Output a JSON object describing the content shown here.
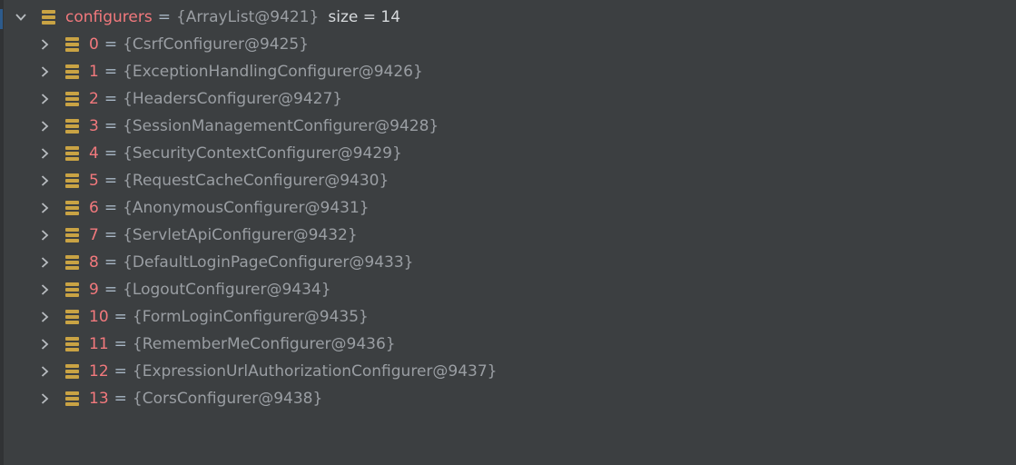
{
  "root": {
    "name": "configurers",
    "eq": "=",
    "ref": "{ArrayList@9421}",
    "size_label": "size = ",
    "size_value": "14"
  },
  "items": [
    {
      "index": "0",
      "eq": "=",
      "ref": "{CsrfConfigurer@9425}"
    },
    {
      "index": "1",
      "eq": "=",
      "ref": "{ExceptionHandlingConfigurer@9426}"
    },
    {
      "index": "2",
      "eq": "=",
      "ref": "{HeadersConfigurer@9427}"
    },
    {
      "index": "3",
      "eq": "=",
      "ref": "{SessionManagementConfigurer@9428}"
    },
    {
      "index": "4",
      "eq": "=",
      "ref": "{SecurityContextConfigurer@9429}"
    },
    {
      "index": "5",
      "eq": "=",
      "ref": "{RequestCacheConfigurer@9430}"
    },
    {
      "index": "6",
      "eq": "=",
      "ref": "{AnonymousConfigurer@9431}"
    },
    {
      "index": "7",
      "eq": "=",
      "ref": "{ServletApiConfigurer@9432}"
    },
    {
      "index": "8",
      "eq": "=",
      "ref": "{DefaultLoginPageConfigurer@9433}"
    },
    {
      "index": "9",
      "eq": "=",
      "ref": "{LogoutConfigurer@9434}"
    },
    {
      "index": "10",
      "eq": "=",
      "ref": "{FormLoginConfigurer@9435}"
    },
    {
      "index": "11",
      "eq": "=",
      "ref": "{RememberMeConfigurer@9436}"
    },
    {
      "index": "12",
      "eq": "=",
      "ref": "{ExpressionUrlAuthorizationConfigurer@9437}"
    },
    {
      "index": "13",
      "eq": "=",
      "ref": "{CorsConfigurer@9438}"
    }
  ],
  "colors": {
    "background": "#3c3f41",
    "field_name": "#f2797d",
    "reference": "#9a9ea3",
    "field_icon": "#c9a344"
  },
  "icons": {
    "expanded": "chevron-down-icon",
    "collapsed": "chevron-right-icon",
    "field": "field-icon"
  }
}
